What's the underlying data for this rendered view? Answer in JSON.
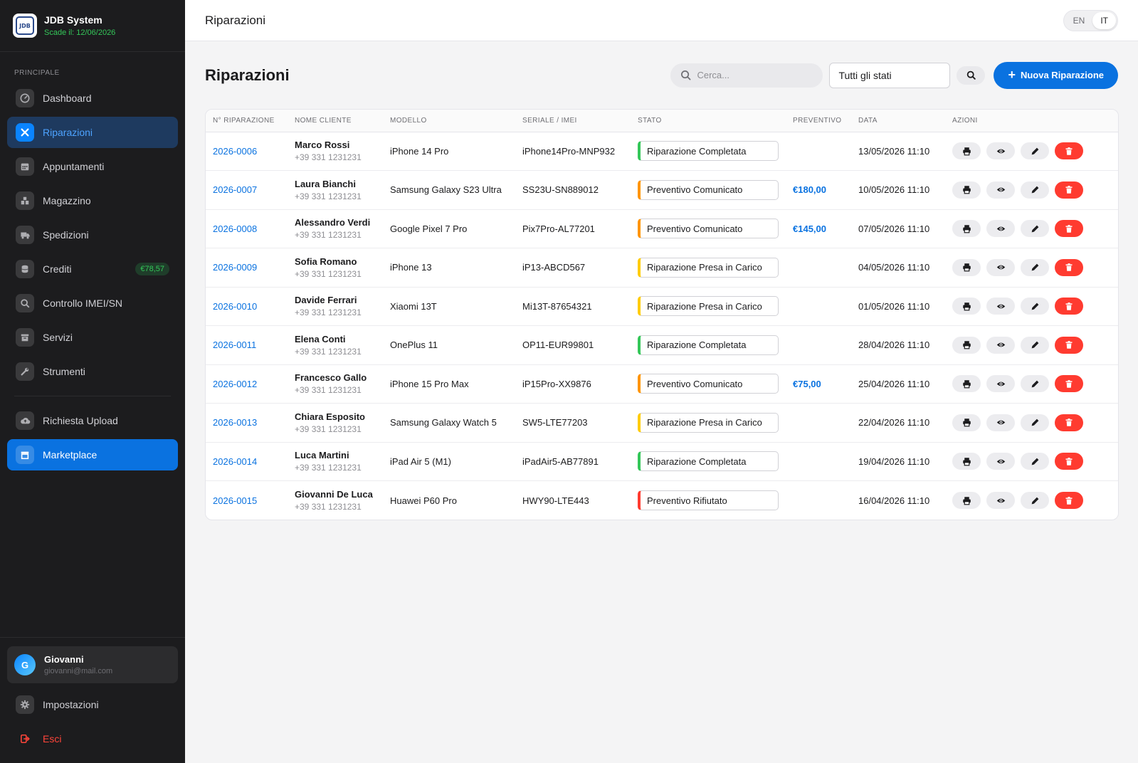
{
  "brand": {
    "name": "JDB System",
    "logo_text": "JDB",
    "expiry": "Scade il: 12/06/2026"
  },
  "sidebar": {
    "section_label": "Principale",
    "items": [
      {
        "label": "Dashboard",
        "icon": "dashboard-icon"
      },
      {
        "label": "Riparazioni",
        "icon": "wrench-icon"
      },
      {
        "label": "Appuntamenti",
        "icon": "calendar-icon"
      },
      {
        "label": "Magazzino",
        "icon": "warehouse-icon"
      },
      {
        "label": "Spedizioni",
        "icon": "truck-icon"
      },
      {
        "label": "Crediti",
        "icon": "coins-icon",
        "badge": "€78,57"
      },
      {
        "label": "Controllo IMEI/SN",
        "icon": "search-icon"
      },
      {
        "label": "Servizi",
        "icon": "box-icon"
      },
      {
        "label": "Strumenti",
        "icon": "tools-icon"
      },
      {
        "label": "Richiesta Upload",
        "icon": "cloud-upload-icon"
      },
      {
        "label": "Marketplace",
        "icon": "store-icon"
      }
    ],
    "user": {
      "initial": "G",
      "name": "Giovanni",
      "email": "giovanni@mail.com"
    },
    "settings_label": "Impostazioni",
    "logout_label": "Esci"
  },
  "topbar": {
    "title": "Riparazioni",
    "lang_en": "EN",
    "lang_it": "IT",
    "active_lang": "IT"
  },
  "page": {
    "title": "Riparazioni",
    "search_placeholder": "Cerca...",
    "status_filter": "Tutti gli stati",
    "new_button": "Nuova Riparazione"
  },
  "table": {
    "headers": [
      "N° RIPARAZIONE",
      "NOME CLIENTE",
      "MODELLO",
      "SERIALE / IMEI",
      "STATO",
      "PREVENTIVO",
      "DATA",
      "AZIONI"
    ],
    "rows": [
      {
        "id": "2026-0006",
        "name": "Marco Rossi",
        "phone": "+39 331 1231231",
        "model": "iPhone 14 Pro",
        "serial": "iPhone14Pro-MNP932",
        "status": "Riparazione Completata",
        "status_color": "green",
        "quote": "",
        "date": "13/05/2026 11:10"
      },
      {
        "id": "2026-0007",
        "name": "Laura Bianchi",
        "phone": "+39 331 1231231",
        "model": "Samsung Galaxy S23 Ultra",
        "serial": "SS23U-SN889012",
        "status": "Preventivo Comunicato",
        "status_color": "orange",
        "quote": "€180,00",
        "date": "10/05/2026 11:10"
      },
      {
        "id": "2026-0008",
        "name": "Alessandro Verdi",
        "phone": "+39 331 1231231",
        "model": "Google Pixel 7 Pro",
        "serial": "Pix7Pro-AL77201",
        "status": "Preventivo Comunicato",
        "status_color": "orange",
        "quote": "€145,00",
        "date": "07/05/2026 11:10"
      },
      {
        "id": "2026-0009",
        "name": "Sofia Romano",
        "phone": "+39 331 1231231",
        "model": "iPhone 13",
        "serial": "iP13-ABCD567",
        "status": "Riparazione Presa in Carico",
        "status_color": "yellow",
        "quote": "",
        "date": "04/05/2026 11:10"
      },
      {
        "id": "2026-0010",
        "name": "Davide Ferrari",
        "phone": "+39 331 1231231",
        "model": "Xiaomi 13T",
        "serial": "Mi13T-87654321",
        "status": "Riparazione Presa in Carico",
        "status_color": "yellow",
        "quote": "",
        "date": "01/05/2026 11:10"
      },
      {
        "id": "2026-0011",
        "name": "Elena Conti",
        "phone": "+39 331 1231231",
        "model": "OnePlus 11",
        "serial": "OP11-EUR99801",
        "status": "Riparazione Completata",
        "status_color": "green",
        "quote": "",
        "date": "28/04/2026 11:10"
      },
      {
        "id": "2026-0012",
        "name": "Francesco Gallo",
        "phone": "+39 331 1231231",
        "model": "iPhone 15 Pro Max",
        "serial": "iP15Pro-XX9876",
        "status": "Preventivo Comunicato",
        "status_color": "orange",
        "quote": "€75,00",
        "date": "25/04/2026 11:10"
      },
      {
        "id": "2026-0013",
        "name": "Chiara Esposito",
        "phone": "+39 331 1231231",
        "model": "Samsung Galaxy Watch 5",
        "serial": "SW5-LTE77203",
        "status": "Riparazione Presa in Carico",
        "status_color": "yellow",
        "quote": "",
        "date": "22/04/2026 11:10"
      },
      {
        "id": "2026-0014",
        "name": "Luca Martini",
        "phone": "+39 331 1231231",
        "model": "iPad Air 5 (M1)",
        "serial": "iPadAir5-AB77891",
        "status": "Riparazione Completata",
        "status_color": "green",
        "quote": "",
        "date": "19/04/2026 11:10"
      },
      {
        "id": "2026-0015",
        "name": "Giovanni De Luca",
        "phone": "+39 331 1231231",
        "model": "Huawei P60 Pro",
        "serial": "HWY90-LTE443",
        "status": "Preventivo Rifiutato",
        "status_color": "red",
        "quote": "",
        "date": "16/04/2026 11:10"
      }
    ]
  },
  "colors": {
    "accent": "#0a72e0",
    "sidebar_bg": "#1c1c1e",
    "success": "#34c759",
    "warning": "#ff9500",
    "pending": "#ffcc00",
    "danger": "#ff3b30"
  }
}
